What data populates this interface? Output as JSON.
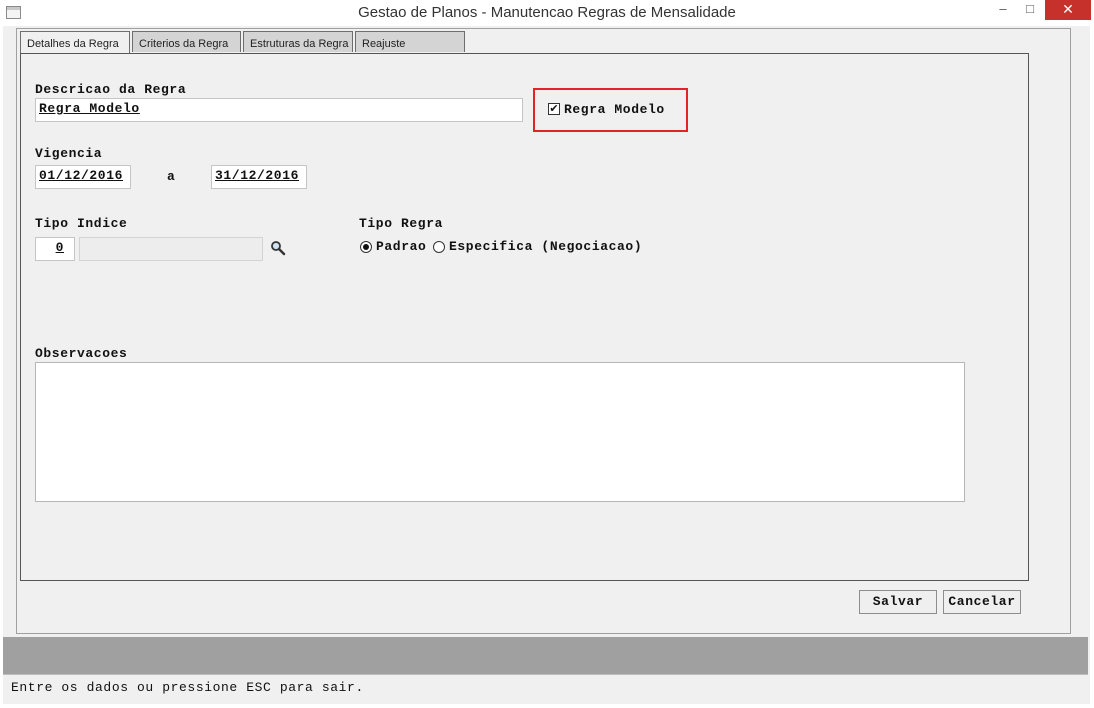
{
  "window": {
    "title": "Gestao de Planos - Manutencao Regras de Mensalidade",
    "minimize": "–",
    "maximize": "□",
    "close": "✕"
  },
  "tabs": [
    {
      "label": "Detalhes da Regra",
      "active": true
    },
    {
      "label": "Criterios da Regra",
      "active": false
    },
    {
      "label": "Estruturas da Regra",
      "active": false
    },
    {
      "label": "Reajuste",
      "active": false
    }
  ],
  "form": {
    "descricao_label": "Descricao da Regra",
    "descricao_value": "Regra Modelo",
    "regra_modelo_label": "Regra Modelo",
    "regra_modelo_checked": true,
    "vigencia_label": "Vigencia",
    "vigencia_from": "01/12/2016",
    "vigencia_sep": "a",
    "vigencia_to": "31/12/2016",
    "tipo_indice_label": "Tipo Indice",
    "tipo_indice_value": "0",
    "tipo_regra_label": "Tipo Regra",
    "tipo_regra_options": [
      "Padrao",
      "Especifica (Negociacao)"
    ],
    "tipo_regra_selected": "Padrao",
    "observacoes_label": "Observacoes",
    "observacoes_value": ""
  },
  "buttons": {
    "salvar": "Salvar",
    "cancelar": "Cancelar"
  },
  "status": "Entre os dados ou pressione ESC para sair.",
  "colors": {
    "highlight": "#e0242a",
    "close_button": "#c7312b"
  },
  "icons": {
    "search": "magnifier-icon",
    "check": "checkmark"
  }
}
